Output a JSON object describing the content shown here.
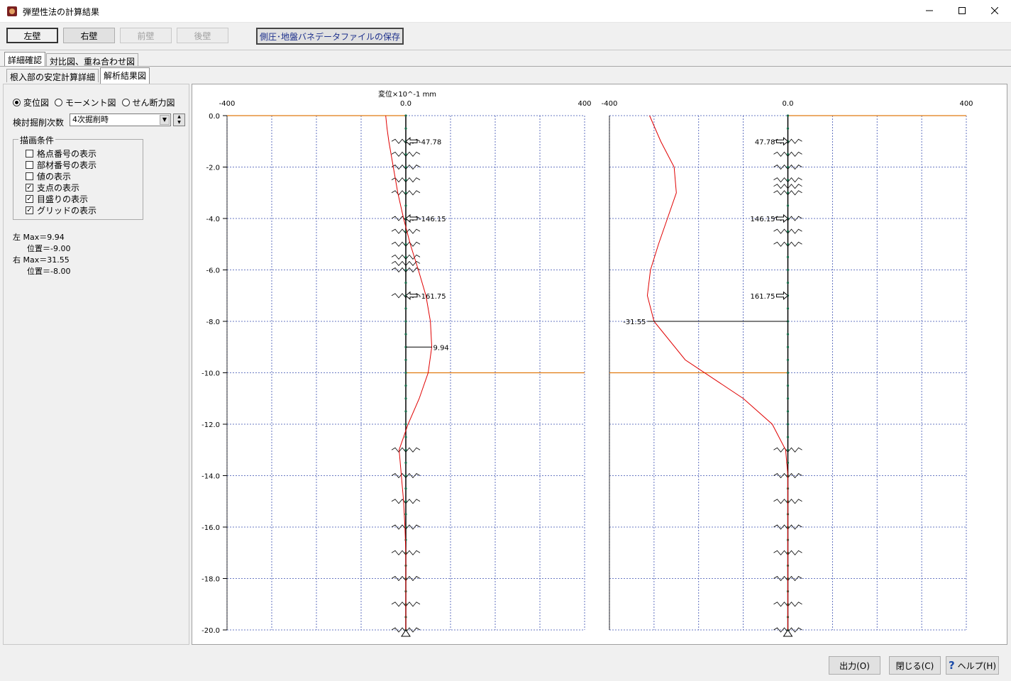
{
  "window": {
    "title": "弾塑性法の計算結果"
  },
  "toolbar": {
    "left_wall": "左壁",
    "right_wall": "右壁",
    "front_wall": "前壁",
    "rear_wall": "後壁",
    "save_label": "側圧･地盤バネデータファイルの保存"
  },
  "tabs_top": [
    "詳細確認",
    "対比図、重ね合わせ図"
  ],
  "tabs_sub": [
    "根入部の安定計算詳細",
    "解析結果図"
  ],
  "left_panel": {
    "radio_displacement": "変位図",
    "radio_moment": "モーメント図",
    "radio_shear": "せん断力図",
    "excavation_label": "検討掘削次数",
    "excavation_value": "4次掘削時",
    "group_title": "描画条件",
    "options": [
      {
        "label": "格点番号の表示",
        "checked": false
      },
      {
        "label": "部材番号の表示",
        "checked": false
      },
      {
        "label": "値の表示",
        "checked": false
      },
      {
        "label": "支点の表示",
        "checked": true
      },
      {
        "label": "目盛りの表示",
        "checked": true
      },
      {
        "label": "グリッドの表示",
        "checked": true
      }
    ],
    "left_max": "左 Max＝9.94",
    "left_pos": "位置＝-9.00",
    "right_max": "右 Max＝31.55",
    "right_pos": "位置＝-8.00"
  },
  "bottom": {
    "output": "出力(O)",
    "close": "閉じる(C)",
    "help": "ヘルプ(H)"
  },
  "chart_data": [
    {
      "type": "line",
      "panel": "left wall",
      "title": "変位×10^-1 mm",
      "xlim": [
        -400,
        400
      ],
      "ylim": [
        -20,
        0
      ],
      "xticks": [
        "-400",
        "0.0",
        "400"
      ],
      "yticks": [
        "0.0",
        "-2.0",
        "-4.0",
        "-6.0",
        "-8.0",
        "-10.0",
        "-12.0",
        "-14.0",
        "-16.0",
        "-18.0",
        "-20.0"
      ],
      "grid": true,
      "series": [
        {
          "x": [
            -45,
            -42,
            -38,
            -28,
            -18,
            -5,
            10,
            28,
            45,
            55,
            58,
            50,
            30,
            5,
            -15,
            -10,
            -5,
            -2,
            0,
            0,
            0,
            0
          ],
          "y": [
            0,
            -0.5,
            -1,
            -2,
            -3,
            -4,
            -5,
            -6,
            -7,
            -8,
            -9,
            -10,
            -11,
            -12,
            -13,
            -14,
            -15,
            -16,
            -17,
            -18,
            -19,
            -20
          ]
        }
      ],
      "strut_loads": [
        {
          "depth": -1.0,
          "label": "-47.78"
        },
        {
          "depth": -4.0,
          "label": "-146.15"
        },
        {
          "depth": -7.0,
          "label": "-161.75"
        }
      ],
      "max_marker": {
        "depth": -9.0,
        "x": 58,
        "label": "9.94"
      },
      "ground_levels": [
        0,
        -10
      ],
      "spring_depths": [
        -1.0,
        -1.5,
        -2.0,
        -2.5,
        -3.0,
        -4.0,
        -4.5,
        -5.0,
        -5.5,
        -5.75,
        -6.0,
        -7.0,
        -13.0,
        -14.0,
        -15.0,
        -16.0,
        -17.0,
        -18.0,
        -19.0,
        -20.0
      ]
    },
    {
      "type": "line",
      "panel": "right wall",
      "xlim": [
        -400,
        400
      ],
      "ylim": [
        -20,
        0
      ],
      "xticks": [
        "-400",
        "0.0",
        "400"
      ],
      "yticks": [
        "0.0",
        "-2.0",
        "-4.0",
        "-6.0",
        "-8.0",
        "-10.0",
        "-12.0",
        "-14.0",
        "-16.0",
        "-18.0",
        "-20.0"
      ],
      "grid": true,
      "series": [
        {
          "x": [
            -310,
            -285,
            -255,
            -250,
            -270,
            -290,
            -308,
            -315,
            -300,
            -230,
            -100,
            -35,
            -5,
            0,
            0,
            0,
            0
          ],
          "y": [
            0,
            -1,
            -2,
            -3,
            -4,
            -5,
            -6,
            -7,
            -8,
            -9.5,
            -11,
            -12,
            -13,
            -14,
            -16,
            -18,
            -20
          ]
        }
      ],
      "strut_loads": [
        {
          "depth": -1.0,
          "label": "47.78"
        },
        {
          "depth": -4.0,
          "label": "146.15"
        },
        {
          "depth": -7.0,
          "label": "161.75"
        }
      ],
      "max_marker": {
        "depth": -8.0,
        "x": -315,
        "label": "-31.55"
      },
      "ground_levels": [
        0,
        -10
      ],
      "spring_depths": [
        -1.0,
        -1.5,
        -2.0,
        -2.5,
        -2.75,
        -3.0,
        -4.0,
        -4.5,
        -5.0,
        -13.0,
        -14.0,
        -15.0,
        -16.0,
        -17.0,
        -18.0,
        -19.0,
        -20.0
      ]
    }
  ]
}
